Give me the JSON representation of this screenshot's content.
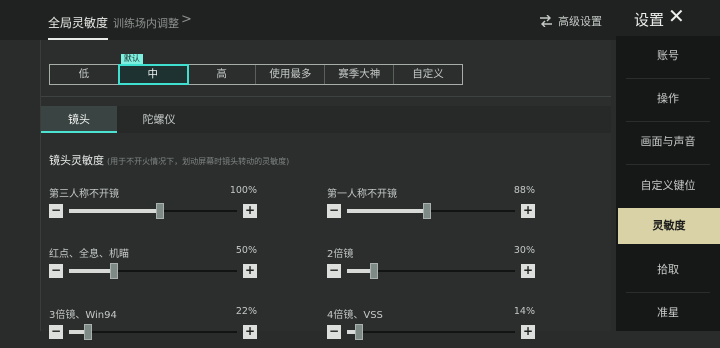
{
  "header": {
    "active_tab": "全局灵敏度",
    "second_tab": "训练场内调整",
    "chevron": ">",
    "advanced_label": "高级设置",
    "advanced_icon": "sliders-swap-icon",
    "settings_title": "设置",
    "close_glyph": "✕"
  },
  "presets": {
    "default_badge": "默认",
    "items": [
      "低",
      "中",
      "高",
      "使用最多",
      "赛季大神",
      "自定义"
    ],
    "selected": "中"
  },
  "subtabs": [
    "镜头",
    "陀螺仪"
  ],
  "section": {
    "title": "镜头灵敏度",
    "hint": "(用于不开火情况下，划动屏幕时镜头转动的灵敏度)"
  },
  "sliders": [
    {
      "label": "第三人称不开镜",
      "value": "100%",
      "level": 100
    },
    {
      "label": "第一人称不开镜",
      "value": "88%",
      "level": 88
    },
    {
      "label": "红点、全息、机瞄",
      "value": "50%",
      "level": 50
    },
    {
      "label": "2倍镜",
      "value": "30%",
      "level": 30
    },
    {
      "label": "3倍镜、Win94",
      "value": "22%",
      "level": 22
    },
    {
      "label": "4倍镜、VSS",
      "value": "14%",
      "level": 14
    }
  ],
  "slider_buttons": {
    "minus": "−",
    "plus": "+"
  },
  "sidebar": {
    "items": [
      "账号",
      "操作",
      "画面与声音",
      "自定义键位",
      "灵敏度",
      "拾取",
      "准星"
    ],
    "selected": "灵敏度"
  },
  "colors": {
    "accent_teal": "#3fe0cf",
    "sidebar_selected": "#d9d2a6"
  }
}
